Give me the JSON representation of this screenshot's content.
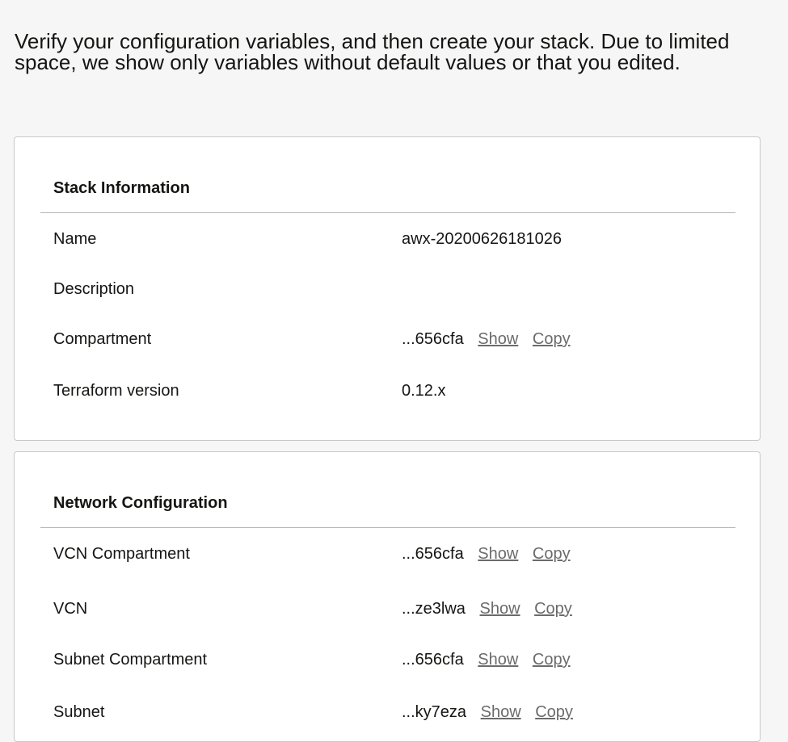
{
  "intro": "Verify your configuration variables, and then create your stack. Due to limited space, we show only variables without default values or that you edited.",
  "sections": [
    {
      "title": "Stack Information",
      "rows": [
        {
          "label": "Name",
          "value": "awx-20200626181026"
        },
        {
          "label": "Description",
          "value": ""
        },
        {
          "label": "Compartment",
          "value": "...656cfa",
          "show": "Show",
          "copy": "Copy"
        },
        {
          "label": "Terraform version",
          "value": "0.12.x"
        }
      ]
    },
    {
      "title": "Network Configuration",
      "rows": [
        {
          "label": "VCN Compartment",
          "value": "...656cfa",
          "show": "Show",
          "copy": "Copy"
        },
        {
          "label": "VCN",
          "value": "...ze3lwa",
          "show": "Show",
          "copy": "Copy"
        },
        {
          "label": "Subnet Compartment",
          "value": "...656cfa",
          "show": "Show",
          "copy": "Copy"
        },
        {
          "label": "Subnet",
          "value": "...ky7eza",
          "show": "Show",
          "copy": "Copy"
        }
      ]
    }
  ]
}
